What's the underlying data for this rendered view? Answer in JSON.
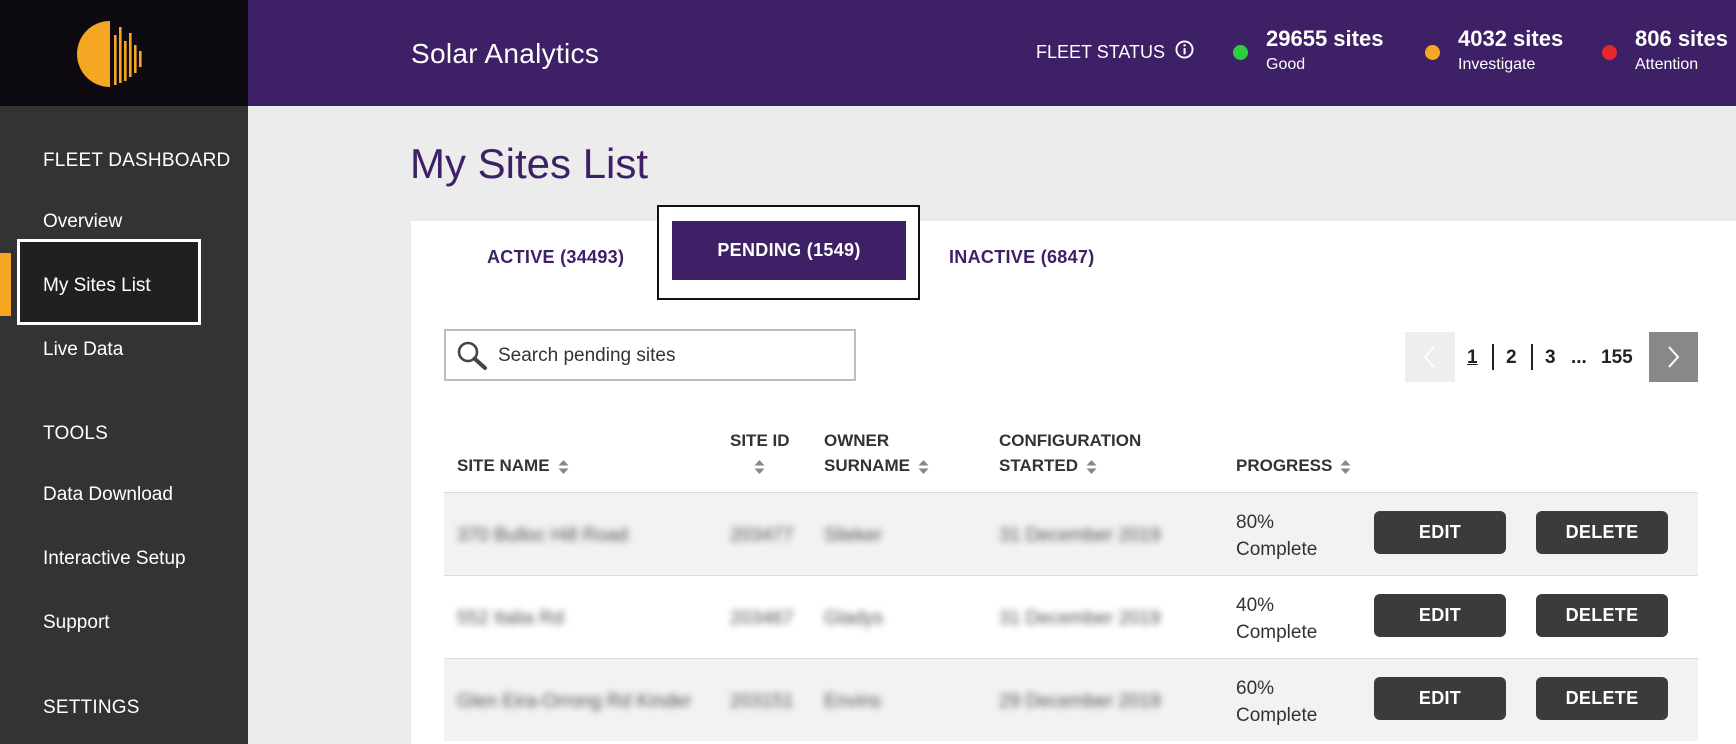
{
  "header": {
    "app_title": "Solar Analytics",
    "fleet_status_label": "FLEET STATUS",
    "statuses": [
      {
        "count": "29655 sites",
        "label": "Good",
        "color": "#2ecc40"
      },
      {
        "count": "4032 sites",
        "label": "Investigate",
        "color": "#f5a623"
      },
      {
        "count": "806 sites",
        "label": "Attention",
        "color": "#e8262b"
      }
    ]
  },
  "sidebar": {
    "sections": [
      {
        "heading": "FLEET DASHBOARD",
        "items": [
          "Overview",
          "My Sites List",
          "Live Data"
        ]
      },
      {
        "heading": "TOOLS",
        "items": [
          "Data Download",
          "Interactive Setup",
          "Support"
        ]
      },
      {
        "heading": "SETTINGS",
        "items": []
      }
    ],
    "active_item": "My Sites List",
    "accent_color": "#f5a623"
  },
  "main": {
    "page_title": "My Sites List",
    "tabs": [
      {
        "label": "ACTIVE (34493)",
        "selected": false
      },
      {
        "label": "PENDING (1549)",
        "selected": true
      },
      {
        "label": "INACTIVE (6847)",
        "selected": false
      }
    ],
    "search": {
      "placeholder": "Search pending sites",
      "value": ""
    },
    "pagination": {
      "pages": [
        "1",
        "2",
        "3",
        "...",
        "155"
      ],
      "current": "1"
    },
    "table": {
      "columns": [
        {
          "label": "SITE NAME"
        },
        {
          "label_line1": "SITE ID"
        },
        {
          "label_line1": "OWNER",
          "label_line2": "SURNAME"
        },
        {
          "label_line1": "CONFIGURATION",
          "label_line2": "STARTED"
        },
        {
          "label": "PROGRESS"
        }
      ],
      "rows": [
        {
          "site_name": "370 Bulloc Hill Road",
          "site_id": "203477",
          "owner": "Slieker",
          "started": "31 December 2019",
          "progress_value": "80%",
          "progress_word": "Complete",
          "edit": "EDIT",
          "delete": "DELETE"
        },
        {
          "site_name": "552 Italia Rd",
          "site_id": "203467",
          "owner": "Gladys",
          "started": "31 December 2019",
          "progress_value": "40%",
          "progress_word": "Complete",
          "edit": "EDIT",
          "delete": "DELETE"
        },
        {
          "site_name": "Glen Eira-Orrong Rd Kinder",
          "site_id": "203151",
          "owner": "Envins",
          "started": "29 December 2019",
          "progress_value": "60%",
          "progress_word": "Complete",
          "edit": "EDIT",
          "delete": "DELETE"
        }
      ]
    }
  }
}
